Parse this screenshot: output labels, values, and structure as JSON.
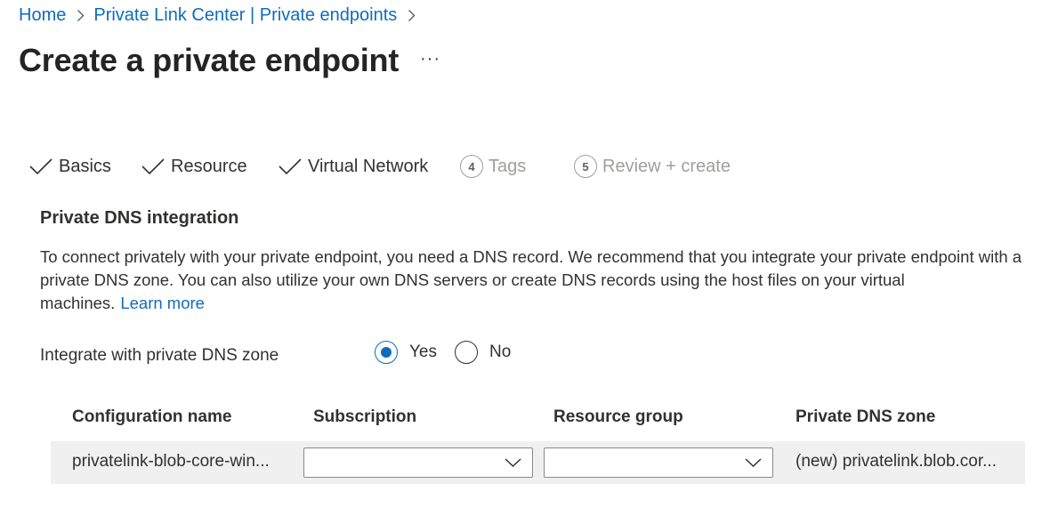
{
  "breadcrumb": {
    "home": "Home",
    "parent": "Private Link Center | Private endpoints"
  },
  "page": {
    "title": "Create a private endpoint",
    "more": "···"
  },
  "steps": [
    {
      "label": "Basics",
      "status": "done"
    },
    {
      "label": "Resource",
      "status": "done"
    },
    {
      "label": "Virtual Network",
      "status": "done"
    },
    {
      "number": "4",
      "label": "Tags",
      "status": "pending"
    },
    {
      "number": "5",
      "label": "Review + create",
      "status": "pending"
    }
  ],
  "dns": {
    "section_title": "Private DNS integration",
    "description": "To connect privately with your private endpoint, you need a DNS record. We recommend that you integrate your private endpoint with a private DNS zone. You can also utilize your own DNS servers or create DNS records using the host files on your virtual machines.",
    "learn_more": "Learn more",
    "integrate_label": "Integrate with private DNS zone",
    "options": [
      {
        "label": "Yes",
        "selected": true
      },
      {
        "label": "No",
        "selected": false
      }
    ]
  },
  "table": {
    "headers": [
      "Configuration name",
      "Subscription",
      "Resource group",
      "Private DNS zone"
    ],
    "rows": [
      {
        "configuration_name": "privatelink-blob-core-win...",
        "subscription": "",
        "resource_group": "",
        "private_dns_zone": "(new) privatelink.blob.cor..."
      }
    ]
  },
  "colors": {
    "accent": "#0f6cbd",
    "text": "#323130",
    "disabled": "#a19f9d",
    "row_bg": "#f0f0f0"
  }
}
